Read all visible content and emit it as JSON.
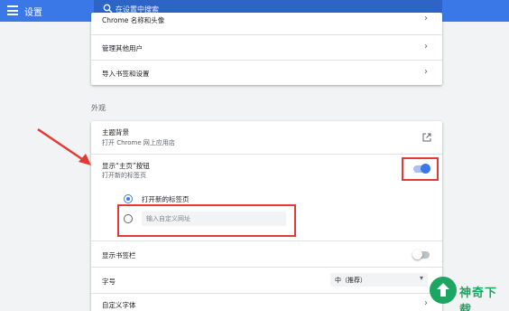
{
  "app": {
    "title": "设置"
  },
  "search": {
    "placeholder": "在设置中搜索"
  },
  "people_card": {
    "items": [
      {
        "label": "Chrome 名称和头像"
      },
      {
        "label": "管理其他用户"
      },
      {
        "label": "导入书签和设置"
      }
    ]
  },
  "appearance": {
    "section_title": "外观",
    "theme": {
      "title": "主题背景",
      "subtitle": "打开 Chrome 网上应用店"
    },
    "home_button": {
      "title": "显示“主页”按钮",
      "subtitle": "打开新的标签页",
      "enabled": true
    },
    "home_options": {
      "option_new_tab": "打开新的标签页",
      "selected": "option_new_tab",
      "custom_url_placeholder": "输入自定义网址",
      "custom_url_value": ""
    },
    "bookmarks_bar": {
      "title": "显示书签栏",
      "enabled": false
    },
    "font_size": {
      "title": "字号",
      "value": "中（推荐）"
    },
    "custom_fonts": {
      "title": "自定义字体"
    }
  },
  "watermark": {
    "text": "神奇下载"
  },
  "colors": {
    "accent": "#3b78e7",
    "highlight": "#e53935",
    "watermark": "#1da562"
  }
}
